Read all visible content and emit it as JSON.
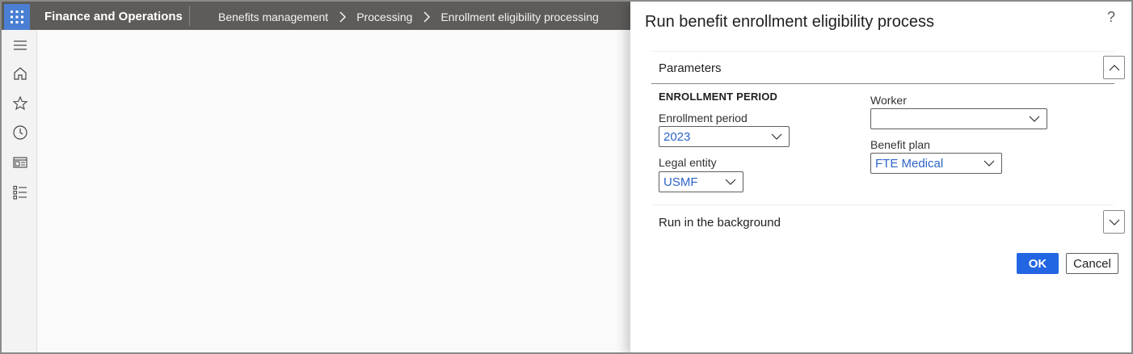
{
  "app": {
    "name": "Finance and Operations"
  },
  "breadcrumb": [
    "Benefits management",
    "Processing",
    "Enrollment eligibility processing"
  ],
  "nav": {
    "icons": [
      "menu-icon",
      "home-icon",
      "star-icon",
      "clock-icon",
      "workspace-icon",
      "list-icon"
    ]
  },
  "dialog": {
    "title": "Run benefit enrollment eligibility process",
    "help": "?",
    "parameters": {
      "header": "Parameters",
      "group_title": "ENROLLMENT PERIOD",
      "enrollment_period": {
        "label": "Enrollment period",
        "value": "2023"
      },
      "legal_entity": {
        "label": "Legal entity",
        "value": "USMF"
      },
      "worker": {
        "label": "Worker",
        "value": ""
      },
      "benefit_plan": {
        "label": "Benefit plan",
        "value": "FTE Medical"
      }
    },
    "background": {
      "header": "Run in the background"
    },
    "ok_label": "OK",
    "cancel_label": "Cancel"
  },
  "colors": {
    "topbar": "#5e5c5a",
    "accent": "#2266e3",
    "value_text": "#2c64c8"
  }
}
